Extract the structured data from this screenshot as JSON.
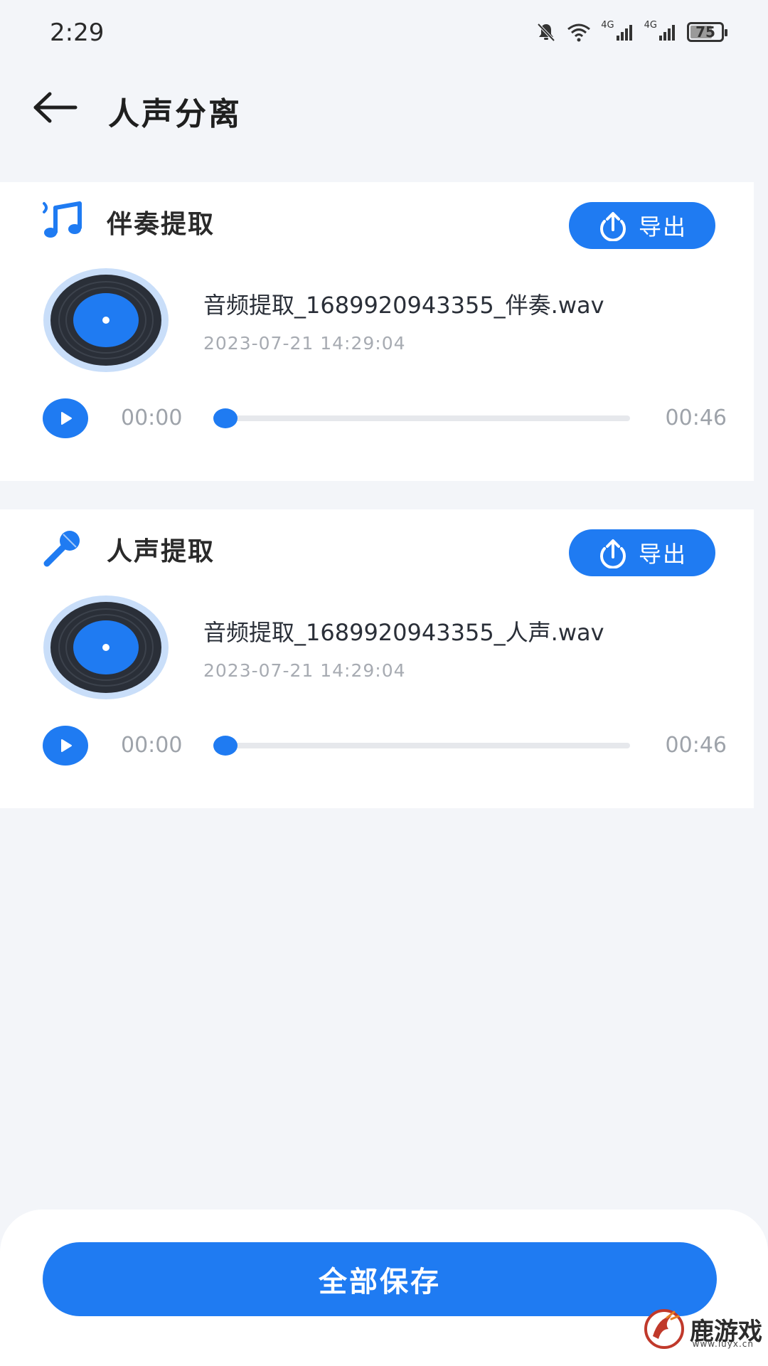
{
  "status_bar": {
    "time": "2:29",
    "network_1": "4G",
    "network_2": "4G",
    "battery": "75",
    "battery_level": 0.75
  },
  "header": {
    "back_icon": "arrow-left-icon",
    "title": "人声分离"
  },
  "cards": [
    {
      "icon": "music-note-icon",
      "title": "伴奏提取",
      "export_label": "导出",
      "file_name": "音频提取_1689920943355_伴奏.wav",
      "file_time": "2023-07-21 14:29:04",
      "current_time": "00:00",
      "duration": "00:46",
      "progress": 0
    },
    {
      "icon": "microphone-icon",
      "title": "人声提取",
      "export_label": "导出",
      "file_name": "音频提取_1689920943355_人声.wav",
      "file_time": "2023-07-21 14:29:04",
      "current_time": "00:00",
      "duration": "00:46",
      "progress": 0
    }
  ],
  "footer": {
    "save_all_label": "全部保存"
  },
  "watermark": {
    "text": "鹿游戏",
    "url": "www.luyx.cn"
  },
  "colors": {
    "accent": "#1f7bf2",
    "background": "#f3f5f9",
    "card": "#ffffff",
    "muted_text": "#a7abb2"
  }
}
